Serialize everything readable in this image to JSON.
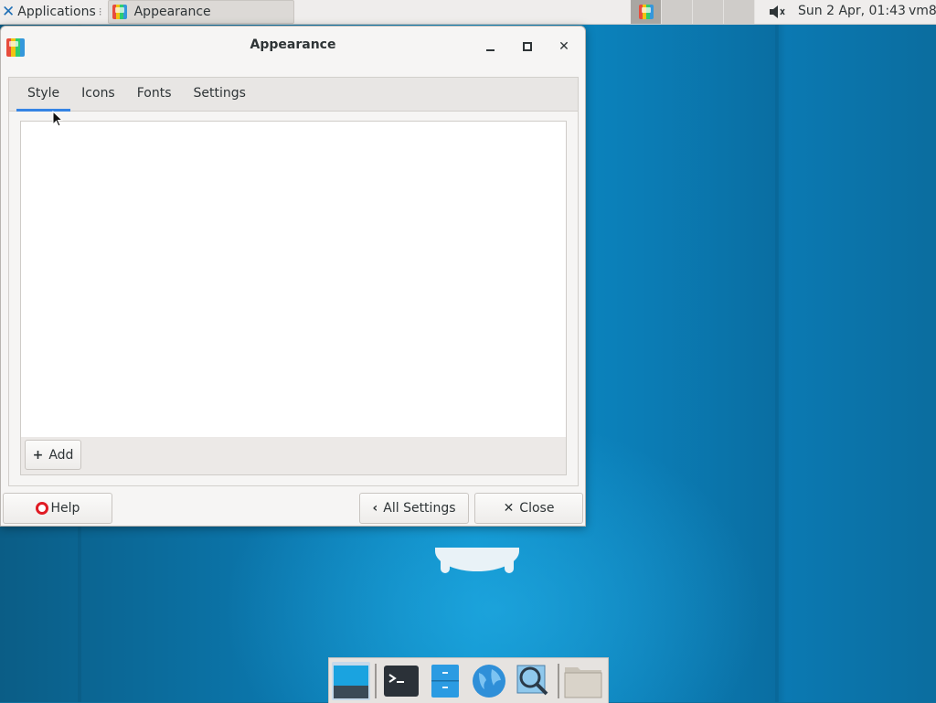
{
  "panel": {
    "apps_label": "Applications",
    "task_label": "Appearance",
    "clock": "Sun  2 Apr, 01:43",
    "user": "vm8"
  },
  "window": {
    "title": "Appearance",
    "tabs": [
      {
        "label": "Style",
        "active": true
      },
      {
        "label": "Icons",
        "active": false
      },
      {
        "label": "Fonts",
        "active": false
      },
      {
        "label": "Settings",
        "active": false
      }
    ],
    "add_label": "Add",
    "help_label": "Help",
    "all_settings_label": "All Settings",
    "close_label": "Close"
  },
  "dock": {
    "items": [
      "show-desktop-icon",
      "terminal-icon",
      "file-manager-icon",
      "web-browser-icon",
      "app-finder-icon",
      "folder-icon"
    ]
  },
  "colors": {
    "accent": "#3584e4",
    "desktop": "#0b79b0",
    "panel": "#efedec"
  }
}
